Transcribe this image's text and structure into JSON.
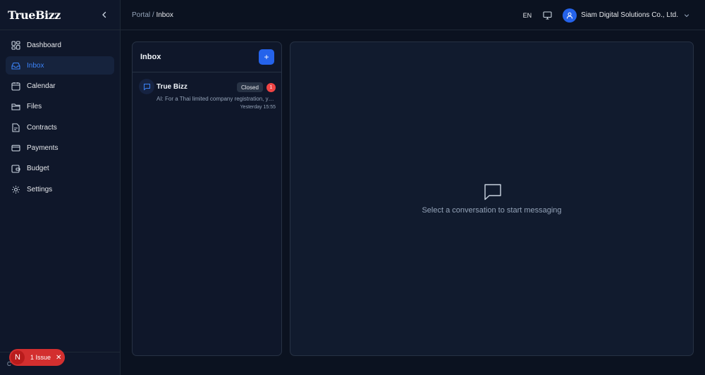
{
  "brand": {
    "logo": "TrueBizz"
  },
  "sidebar": {
    "items": [
      {
        "label": "Dashboard",
        "icon": "grid-icon"
      },
      {
        "label": "Inbox",
        "icon": "inbox-icon",
        "active": true
      },
      {
        "label": "Calendar",
        "icon": "calendar-icon"
      },
      {
        "label": "Files",
        "icon": "folder-icon"
      },
      {
        "label": "Contracts",
        "icon": "contract-icon"
      },
      {
        "label": "Payments",
        "icon": "card-icon"
      },
      {
        "label": "Budget",
        "icon": "wallet-icon"
      },
      {
        "label": "Settings",
        "icon": "gear-icon"
      }
    ],
    "footer_text": "C"
  },
  "header": {
    "breadcrumb_root": "Portal",
    "breadcrumb_sep": " / ",
    "breadcrumb_current": "Inbox",
    "language": "EN",
    "company": "Siam Digital Solutions Co., Ltd."
  },
  "inbox": {
    "title": "Inbox",
    "add_label": "+",
    "conversations": [
      {
        "name": "True Bizz",
        "status": "Closed",
        "unread": "1",
        "preview": "AI: For a Thai limited company registration, you'll need",
        "time": "Yesterday 15:55"
      }
    ]
  },
  "detail": {
    "empty_message": "Select a conversation to start messaging"
  },
  "issue_pill": {
    "letter": "N",
    "text": "1 Issue",
    "close": "✕"
  },
  "colors": {
    "accent": "#2563eb",
    "background": "#0b1220",
    "panel": "#0f172a",
    "danger": "#d32f2f"
  }
}
